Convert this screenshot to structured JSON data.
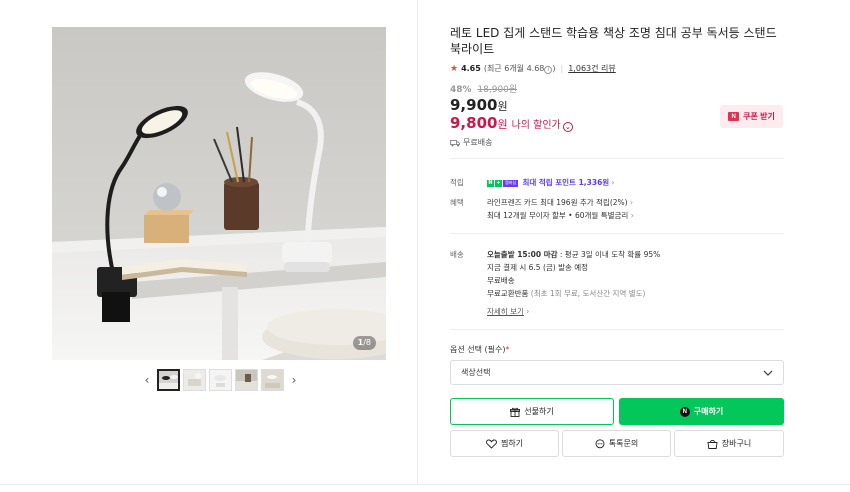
{
  "gallery": {
    "counter_current": "1",
    "counter_total": "/8",
    "prev_icon": "chevron-left-icon",
    "next_icon": "chevron-right-icon"
  },
  "product": {
    "title": "레토 LED 집게 스탠드 학습용 책상 조명 침대 공부 독서등 스탠드 북라이트",
    "rating": {
      "score": "4.65",
      "recent": "(최근 6개월 4.68",
      "recent_close": ")",
      "reviews": "1,063건 리뷰"
    },
    "discount_pct": "48%",
    "original_price": "18,900원",
    "price": "9,900",
    "price_unit": "원",
    "my_price": "9,800",
    "my_price_unit": "원",
    "my_price_label": "나의 할인가",
    "coupon_label": "쿠폰 받기",
    "free_shipping": "무료배송"
  },
  "benefits": {
    "points_label": "적립",
    "points_badge_n": "N",
    "points_badge_plus": "+",
    "points_badge_member": "멤버십",
    "points_text": "최대 적립 포인트 1,336원",
    "benefit_label": "혜택",
    "benefit_line1": "라인프렌즈 카드 최대 196원 추가 적립(2%)",
    "benefit_line2": "최대 12개월 무이자 할부 • 60개월 특별금리"
  },
  "delivery": {
    "label": "배송",
    "today_prefix": "오늘출발 15:00 마감",
    "today_suffix": " : 평균 3일 이내 도착 확률 95%",
    "pay_now": "지금 결제 시 6.5 (금) 발송 예정",
    "free": "무료배송",
    "return_main": "무료교환반품",
    "return_note": " (최초 1회 무료, 도서산간 지역 별도)",
    "details_link": "자세히 보기"
  },
  "options": {
    "label": "옵션 선택 (필수)",
    "required_mark": "*",
    "select_value": "색상선택"
  },
  "actions": {
    "gift": "선물하기",
    "buy": "구매하기",
    "wish": "찜하기",
    "talk": "톡톡문의",
    "cart": "장바구니"
  },
  "colors": {
    "naver_green": "#03c75a",
    "sale_red": "#c9184a",
    "member_purple": "#6a3df0"
  }
}
